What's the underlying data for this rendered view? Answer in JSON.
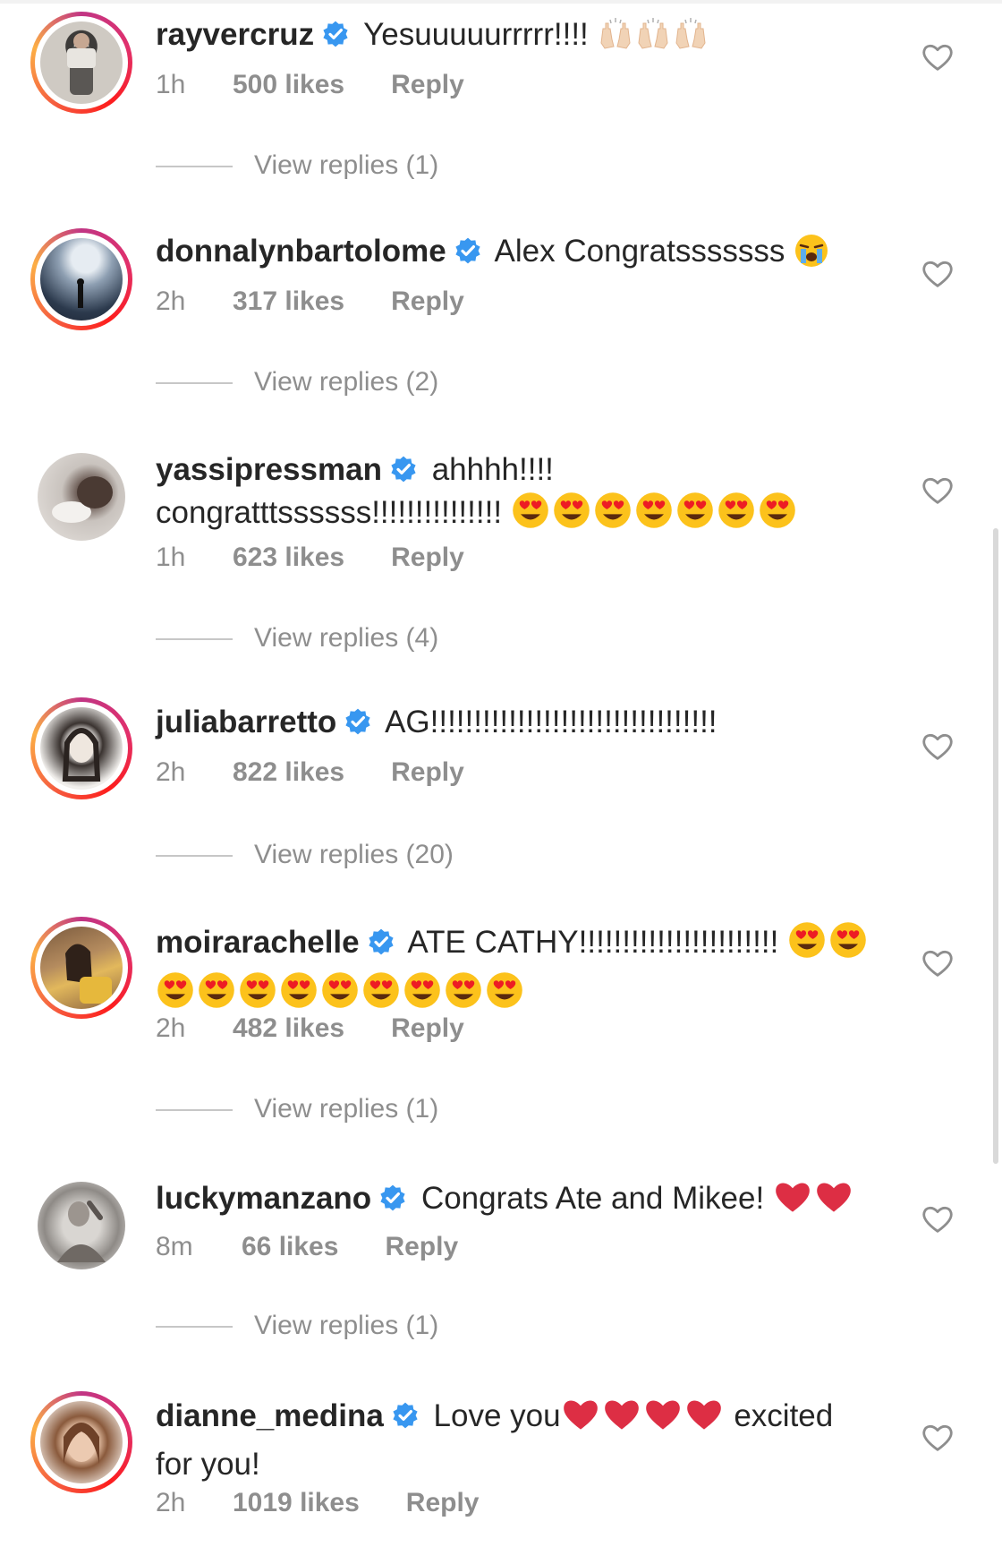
{
  "comments": [
    {
      "username": "rayvercruz",
      "text": "Yesuuuuurrrrr!!!!",
      "time": "1h",
      "likes": "500 likes",
      "reply": "Reply",
      "view_replies": "View replies (1)",
      "emoji_names": [
        "raising-hands-emoji",
        "raising-hands-emoji",
        "raising-hands-emoji"
      ]
    },
    {
      "username": "donnalynbartolome",
      "text": "Alex Congratsssssss",
      "time": "2h",
      "likes": "317 likes",
      "reply": "Reply",
      "view_replies": "View replies (2)",
      "emoji_names": [
        "crying-face-emoji"
      ]
    },
    {
      "username": "yassipressman",
      "text": "ahhhh!!!!",
      "text_line2": "congratttssssss!!!!!!!!!!!!!!!",
      "time": "1h",
      "likes": "623 likes",
      "reply": "Reply",
      "view_replies": "View replies (4)",
      "emoji_names": [
        "heart-eyes-emoji",
        "heart-eyes-emoji",
        "heart-eyes-emoji",
        "heart-eyes-emoji",
        "heart-eyes-emoji",
        "heart-eyes-emoji",
        "heart-eyes-emoji"
      ]
    },
    {
      "username": "juliabarretto",
      "text": "AG!!!!!!!!!!!!!!!!!!!!!!!!!!!!!!!!!",
      "time": "2h",
      "likes": "822 likes",
      "reply": "Reply",
      "view_replies": "View replies (20)"
    },
    {
      "username": "moirarachelle",
      "text": "ATE CATHY!!!!!!!!!!!!!!!!!!!!!!!",
      "time": "2h",
      "likes": "482 likes",
      "reply": "Reply",
      "view_replies": "View replies (1)",
      "emoji_names": [
        "heart-eyes-emoji",
        "heart-eyes-emoji",
        "heart-eyes-emoji",
        "heart-eyes-emoji",
        "heart-eyes-emoji",
        "heart-eyes-emoji",
        "heart-eyes-emoji",
        "heart-eyes-emoji",
        "heart-eyes-emoji",
        "heart-eyes-emoji",
        "heart-eyes-emoji"
      ]
    },
    {
      "username": "luckymanzano",
      "text": "Congrats Ate and Mikee!",
      "time": "8m",
      "likes": "66 likes",
      "reply": "Reply",
      "view_replies": "View replies (1)",
      "emoji_names": [
        "red-heart-emoji",
        "red-heart-emoji"
      ]
    },
    {
      "username": "dianne_medina",
      "text": "Love you",
      "text_after": "excited",
      "text_line2": "for you!",
      "time": "2h",
      "likes": "1019 likes",
      "reply": "Reply",
      "emoji_names": [
        "red-heart-emoji",
        "red-heart-emoji",
        "red-heart-emoji",
        "red-heart-emoji"
      ]
    }
  ],
  "colors": {
    "verified": "#3897f0",
    "meta": "#8e8e8e",
    "text": "#262626",
    "story_ring": [
      "#c13584",
      "#e1306c",
      "#fd1d1d",
      "#f56040",
      "#fcaf45"
    ]
  }
}
